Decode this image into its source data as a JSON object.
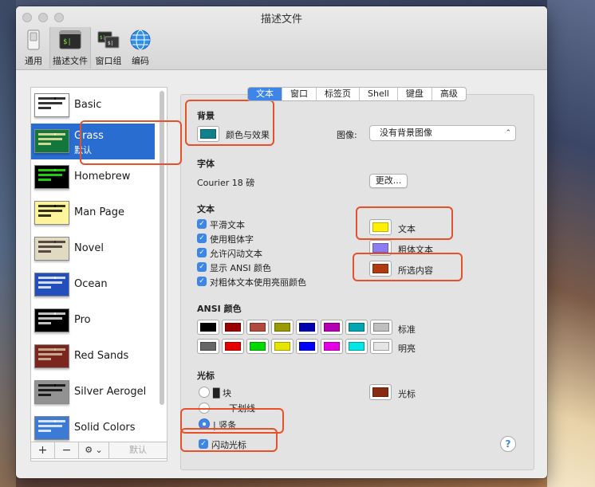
{
  "window": {
    "title": "描述文件"
  },
  "toolbar": {
    "items": [
      {
        "label": "通用",
        "icon": "general-switch-icon"
      },
      {
        "label": "描述文件",
        "icon": "profiles-terminal-icon",
        "selected": true
      },
      {
        "label": "窗口组",
        "icon": "window-groups-icon"
      },
      {
        "label": "编码",
        "icon": "encodings-globe-icon"
      }
    ]
  },
  "sidebar": {
    "profiles": [
      {
        "name": "Basic",
        "bg": "#ffffff",
        "fg": "#000000"
      },
      {
        "name": "Grass",
        "subtitle": "默认",
        "bg": "#13773d",
        "fg": "#fff0a5",
        "selected": true
      },
      {
        "name": "Homebrew",
        "bg": "#000000",
        "fg": "#28fe14"
      },
      {
        "name": "Man Page",
        "bg": "#fef49c",
        "fg": "#000000"
      },
      {
        "name": "Novel",
        "bg": "#dfdbc3",
        "fg": "#3b2322"
      },
      {
        "name": "Ocean",
        "bg": "#224fbc",
        "fg": "#ffffff"
      },
      {
        "name": "Pro",
        "bg": "#000000",
        "fg": "#f2f2f2"
      },
      {
        "name": "Red Sands",
        "bg": "#7a251e",
        "fg": "#d7c9a7"
      },
      {
        "name": "Silver Aerogel",
        "bg": "#929292",
        "fg": "#000000"
      },
      {
        "name": "Solid Colors",
        "bg": "#3b7bd6",
        "fg": "#ffffff"
      }
    ],
    "add_label": "+",
    "remove_label": "−",
    "gear_label": "⚙ ⌄",
    "default_label": "默认"
  },
  "tabs": [
    "文本",
    "窗口",
    "标签页",
    "Shell",
    "键盘",
    "高级"
  ],
  "text_tab": {
    "background": {
      "heading": "背景",
      "color_effects_label": "颜色与效果",
      "swatch_color": "#13808e",
      "image_label": "图像:",
      "image_value": "没有背景图像"
    },
    "font": {
      "heading": "字体",
      "value": "Courier 18 磅",
      "change_button": "更改..."
    },
    "text": {
      "heading": "文本",
      "checkboxes": [
        "平滑文本",
        "使用粗体字",
        "允许闪动文本",
        "显示 ANSI 颜色",
        "对粗体文本使用亮丽颜色"
      ],
      "colors": [
        {
          "label": "文本",
          "color": "#fff000"
        },
        {
          "label": "粗体文本",
          "color": "#8c7ef0"
        },
        {
          "label": "所选内容",
          "color": "#b23a10"
        }
      ]
    },
    "ansi": {
      "heading": "ANSI 颜色",
      "normal_label": "标准",
      "bright_label": "明亮",
      "normal": [
        "#000000",
        "#990000",
        "#b04a3c",
        "#999900",
        "#0000b2",
        "#b200b2",
        "#00a6b2",
        "#bfbfbf"
      ],
      "bright": [
        "#666666",
        "#e50000",
        "#00d900",
        "#e5e500",
        "#0000ff",
        "#e500e5",
        "#00e5e5",
        "#e5e5e5"
      ]
    },
    "cursor": {
      "heading": "光标",
      "options": [
        "█  块",
        "下划线",
        "|  竖条"
      ],
      "selected": 2,
      "color_label": "光标",
      "color": "#8a2a10",
      "blink_label": "闪动光标"
    },
    "help_label": "?"
  }
}
